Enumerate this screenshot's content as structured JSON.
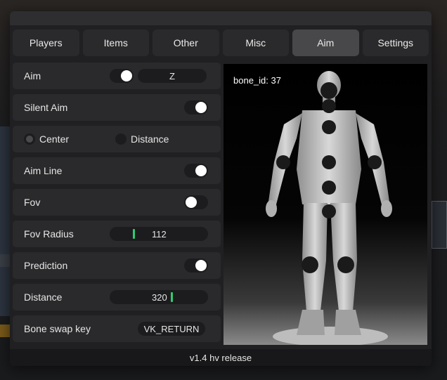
{
  "tabs": [
    {
      "label": "Players",
      "active": false
    },
    {
      "label": "Items",
      "active": false
    },
    {
      "label": "Other",
      "active": false
    },
    {
      "label": "Misc",
      "active": false
    },
    {
      "label": "Aim",
      "active": true
    },
    {
      "label": "Settings",
      "active": false
    }
  ],
  "aim": {
    "label": "Aim",
    "enabled": true,
    "key": "Z"
  },
  "silent_aim": {
    "label": "Silent Aim",
    "enabled": true
  },
  "target_mode": {
    "options": [
      {
        "label": "Center",
        "selected": false
      },
      {
        "label": "Distance",
        "selected": false
      }
    ]
  },
  "aim_line": {
    "label": "Aim Line",
    "enabled": true
  },
  "fov": {
    "label": "Fov",
    "enabled": false
  },
  "fov_radius": {
    "label": "Fov Radius",
    "value": "112"
  },
  "prediction": {
    "label": "Prediction",
    "enabled": true
  },
  "distance": {
    "label": "Distance",
    "value": "320"
  },
  "bone_swap": {
    "label": "Bone swap key",
    "key": "VK_RETURN"
  },
  "preview": {
    "bone_label": "bone_id: 37"
  },
  "footer": {
    "version": "v1.4 hv release"
  },
  "colors": {
    "accent": "#2ecc71",
    "panel": "#2a2a2c",
    "active_tab": "#48484a",
    "window": "#202022"
  }
}
